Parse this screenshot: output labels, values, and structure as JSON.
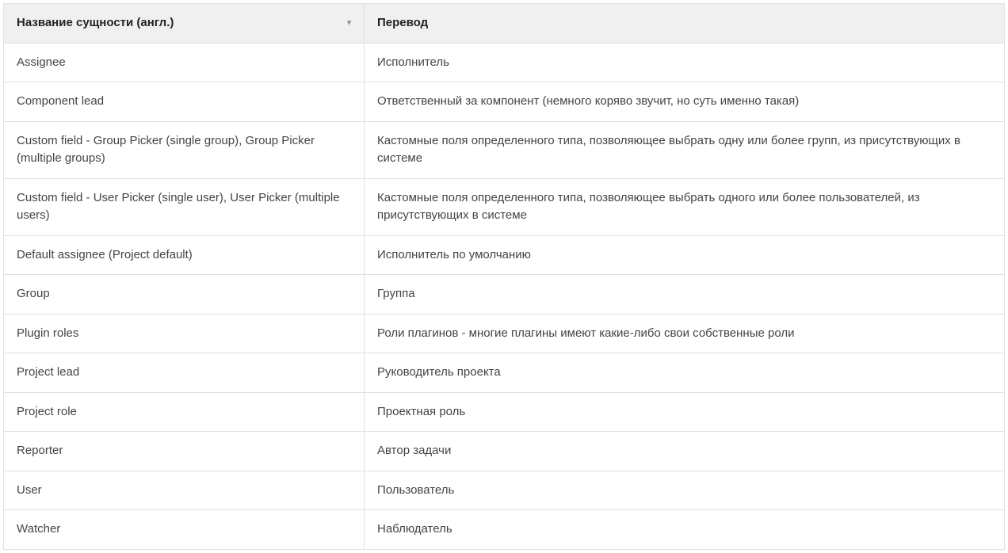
{
  "table": {
    "headers": {
      "english": "Название сущности (англ.)",
      "translation": "Перевод"
    },
    "rows": [
      {
        "english": "Assignee",
        "translation": "Исполнитель"
      },
      {
        "english": "Component lead",
        "translation": "Ответственный за компонент (немного коряво звучит, но суть именно такая)"
      },
      {
        "english": "Custom field - Group Picker (single group), Group Picker (multiple groups)",
        "translation": "Кастомные поля определенного типа, позволяющее выбрать одну или более групп,  из присутствующих в системе"
      },
      {
        "english": "Custom field - User Picker (single user), User Picker (multiple users)",
        "translation": "Кастомные поля определенного типа, позволяющее выбрать одного или более пользователей,  из присутствующих в системе"
      },
      {
        "english": "Default assignee (Project default)",
        "translation": "Исполнитель по умолчанию"
      },
      {
        "english": "Group",
        "translation": "Группа"
      },
      {
        "english": "Plugin roles",
        "translation": "Роли плагинов - многие плагины имеют какие-либо свои собственные роли"
      },
      {
        "english": "Project lead",
        "translation": "Руководитель проекта"
      },
      {
        "english": "Project role",
        "translation": "Проектная роль"
      },
      {
        "english": "Reporter",
        "translation": "Автор задачи"
      },
      {
        "english": "User",
        "translation": "Пользователь"
      },
      {
        "english": "Watcher",
        "translation": "Наблюдатель"
      }
    ]
  }
}
